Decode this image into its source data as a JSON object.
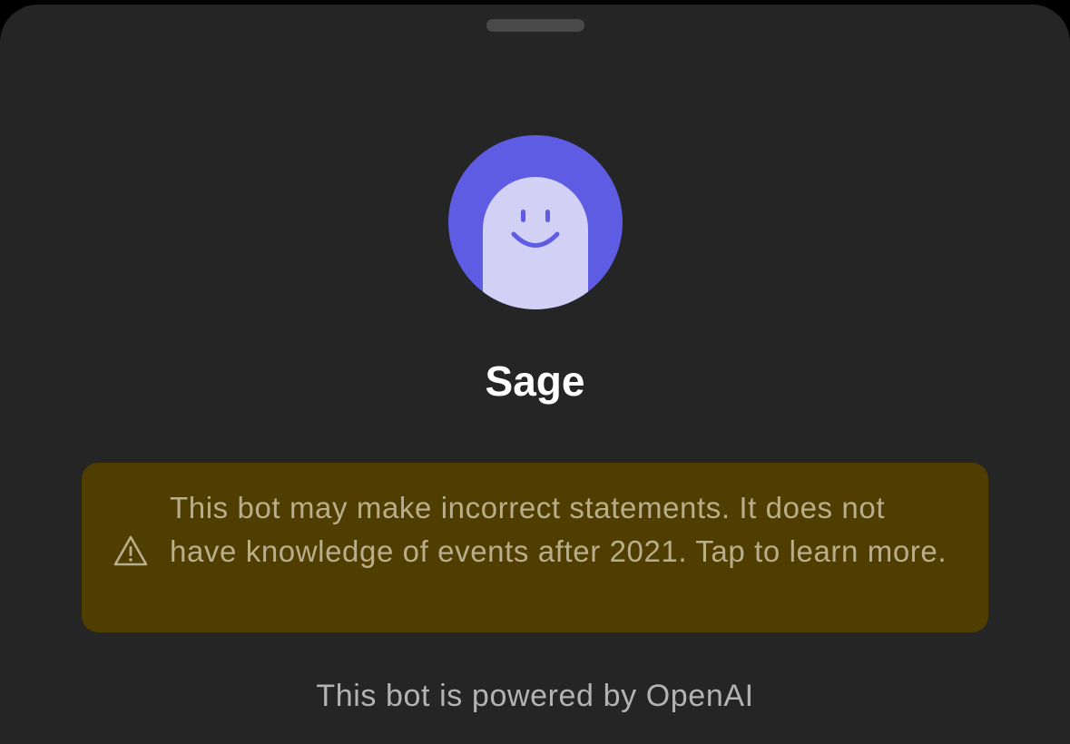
{
  "bot": {
    "name": "Sage",
    "avatar_icon": "smiling-ghost-avatar",
    "avatar_bg_color": "#5d5ce2",
    "avatar_figure_color": "#d2d0f4"
  },
  "disclaimer": {
    "icon": "warning-triangle-icon",
    "text": "This bot may make incorrect statements. It does not have knowledge of events after 2021.  Tap to learn more.",
    "bg_color": "#4f3e00",
    "text_color": "#b9ae8c"
  },
  "footer": {
    "powered_by": "This bot is powered by OpenAI"
  },
  "sheet_bg_color": "#252525"
}
